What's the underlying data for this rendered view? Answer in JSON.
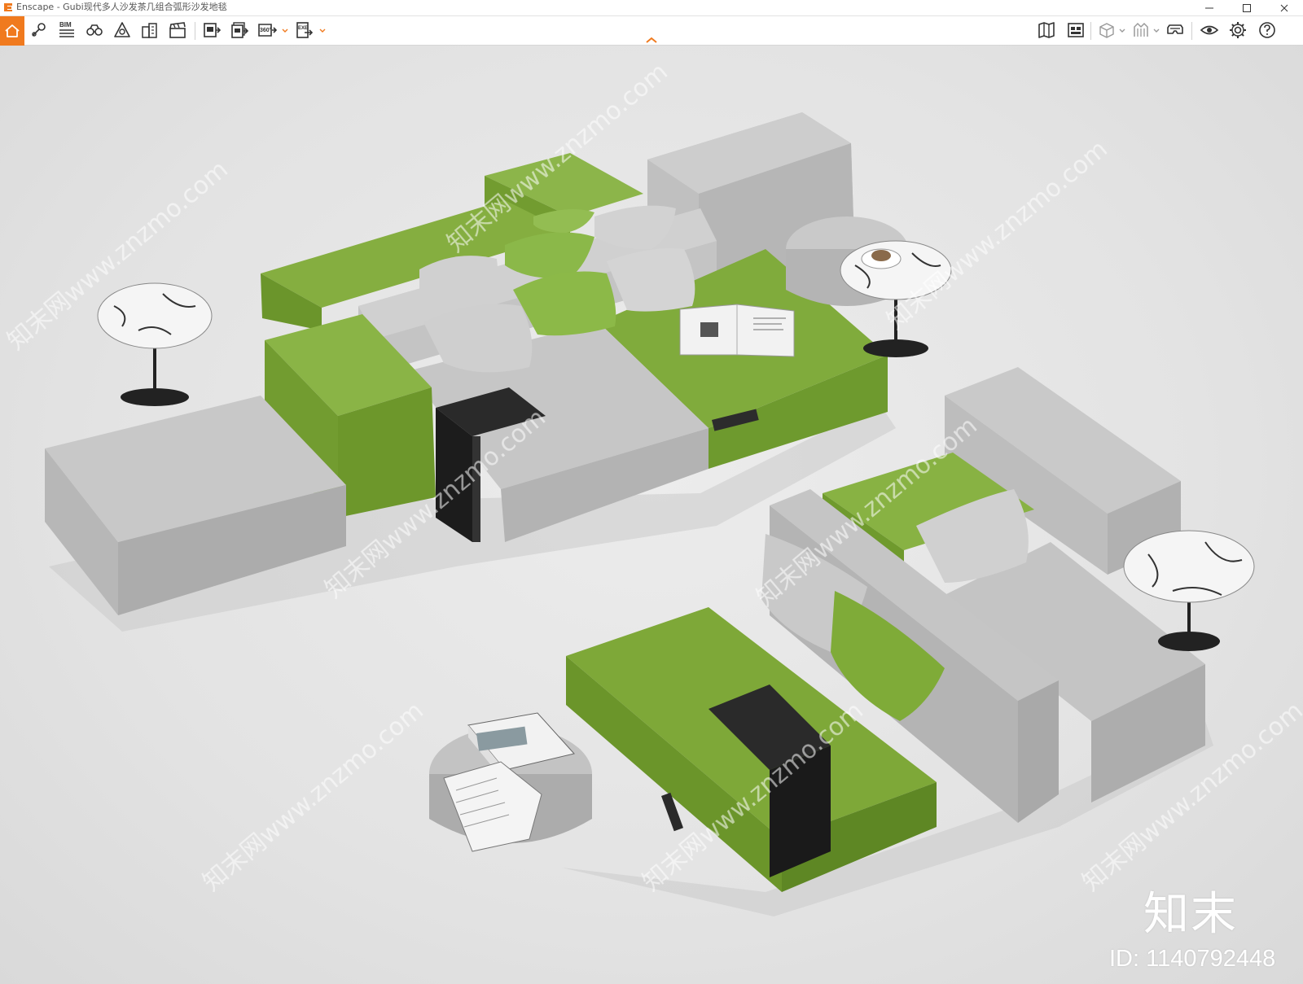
{
  "window": {
    "title": "Enscape - Gubi现代多人沙发茶几组合弧形沙发地毯",
    "accent_color": "#f07a1e"
  },
  "toolbar": {
    "left_icons": [
      "home-icon",
      "location-pin-icon",
      "bim-icon",
      "binoculars-icon",
      "compass-icon",
      "buildings-icon",
      "clapperboard-icon",
      "export-image-icon",
      "batch-export-icon",
      "panorama-360-icon",
      "export-exe-icon"
    ],
    "bim_label": "BIM",
    "pano_label": "360°",
    "exe_label": "EXE",
    "right_icons": [
      "map-icon",
      "asset-library-icon",
      "view-cube-icon",
      "sync-icon",
      "vr-headset-icon",
      "visual-settings-icon",
      "settings-icon",
      "help-icon"
    ]
  },
  "scene": {
    "description_colors": {
      "green": "#7ea838",
      "gray": "#b9b9b9",
      "floor": "#e4e4e4"
    },
    "watermark_text": "知末网www.znzmo.com",
    "watermark_logo": "知末",
    "watermark_id": "ID: 1140792448"
  }
}
